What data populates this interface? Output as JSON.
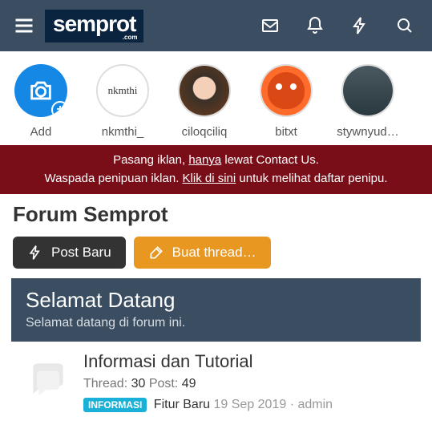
{
  "header": {
    "logo_text": "semprot",
    "logo_domain": ".com"
  },
  "stories": [
    {
      "label": "Add",
      "type": "add"
    },
    {
      "label": "nkmthi_",
      "type": "text",
      "inner": "nkmthi"
    },
    {
      "label": "ciloqciliq",
      "type": "person1"
    },
    {
      "label": "bitxt",
      "type": "bitxt"
    },
    {
      "label": "stywnyud…",
      "type": "man"
    }
  ],
  "banner": {
    "line1_prefix": "Pasang iklan, ",
    "line1_link": "hanya",
    "line1_suffix": " lewat Contact Us.",
    "line2_prefix": "Waspada penipuan iklan. ",
    "line2_link": "Klik di sini",
    "line2_suffix": " untuk melihat daftar penipu."
  },
  "page_title": "Forum Semprot",
  "actions": {
    "post": "Post Baru",
    "thread": "Buat thread…"
  },
  "welcome": {
    "title": "Selamat Datang",
    "subtitle": "Selamat datang di forum ini."
  },
  "section": {
    "title": "Informasi dan Tutorial",
    "thread_label": "Thread:",
    "thread_count": "30",
    "post_label": "Post:",
    "post_count": "49",
    "tag": "INFORMASI",
    "thread_title": "Fitur Baru",
    "date": "19 Sep 2019",
    "sep": "·",
    "author": "admin"
  }
}
